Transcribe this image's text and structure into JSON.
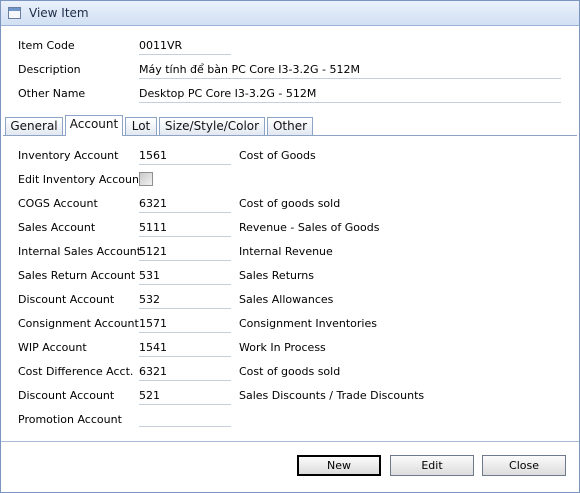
{
  "window": {
    "title": "View Item"
  },
  "header": {
    "item_code_label": "Item Code",
    "item_code_value": "0011VR",
    "description_label": "Description",
    "description_value": "Máy tính để bàn PC Core I3-3.2G - 512M",
    "other_name_label": "Other Name",
    "other_name_value": "Desktop PC Core I3-3.2G - 512M"
  },
  "tabs": [
    {
      "label": "General"
    },
    {
      "label": "Account",
      "active": true
    },
    {
      "label": "Lot"
    },
    {
      "label": "Size/Style/Color"
    },
    {
      "label": "Other"
    }
  ],
  "accounts": [
    {
      "label": "Inventory Account",
      "code": "1561",
      "description": "Cost of Goods"
    },
    {
      "label": "Edit Inventory Account",
      "checked": false
    },
    {
      "label": "COGS Account",
      "code": "6321",
      "description": "Cost of goods sold"
    },
    {
      "label": "Sales Account",
      "code": "5111",
      "description": "Revenue - Sales of Goods"
    },
    {
      "label": "Internal Sales Account",
      "code": "5121",
      "description": "Internal Revenue"
    },
    {
      "label": "Sales Return Account",
      "code": "531",
      "description": "Sales Returns"
    },
    {
      "label": "Discount Account",
      "code": "532",
      "description": "Sales Allowances"
    },
    {
      "label": "Consignment Account",
      "code": "1571",
      "description": "Consignment Inventories"
    },
    {
      "label": "WIP Account",
      "code": "1541",
      "description": "Work In Process"
    },
    {
      "label": "Cost Difference Acct.",
      "code": "6321",
      "description": "Cost of goods sold"
    },
    {
      "label": "Discount Account",
      "code": "521",
      "description": "Sales Discounts / Trade Discounts"
    },
    {
      "label": "Promotion Account",
      "code": "",
      "description": ""
    }
  ],
  "buttons": {
    "new": "New",
    "edit": "Edit",
    "close": "Close"
  }
}
